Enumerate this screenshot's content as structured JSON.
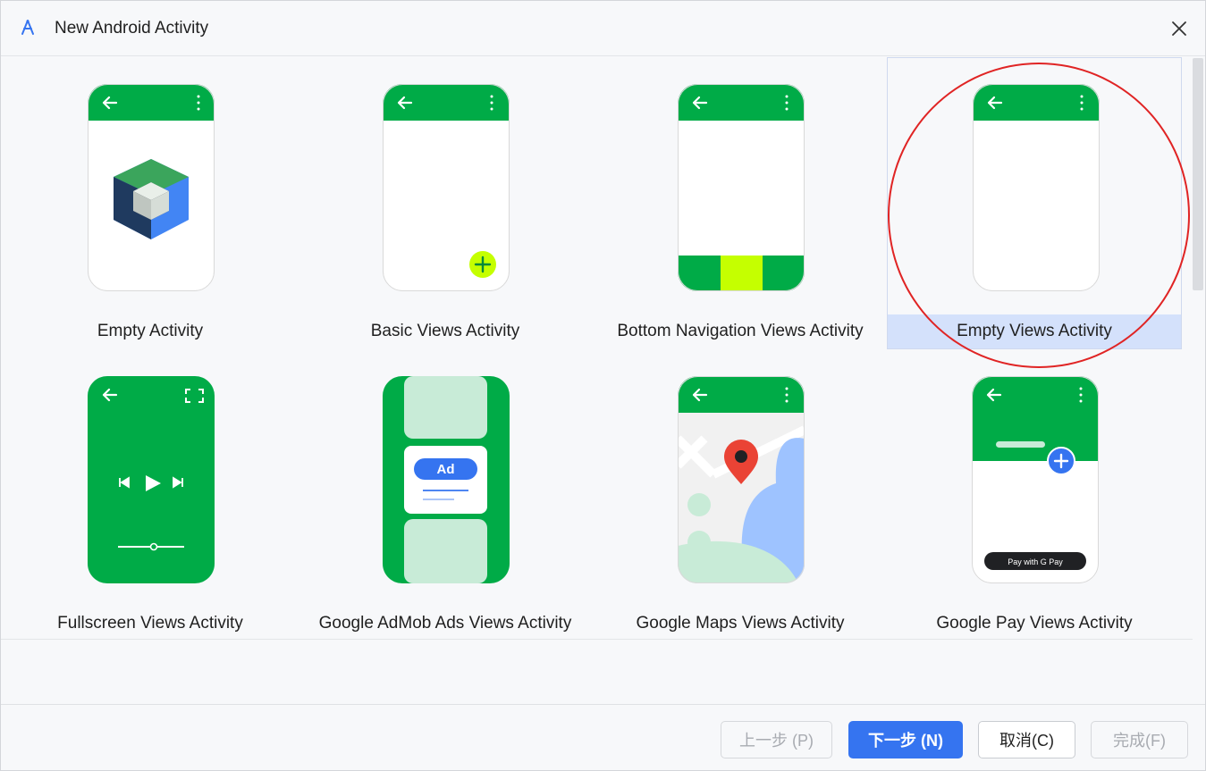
{
  "window": {
    "title": "New Android Activity"
  },
  "templates": [
    {
      "label": "Empty Activity"
    },
    {
      "label": "Basic Views Activity"
    },
    {
      "label": "Bottom Navigation Views Activity"
    },
    {
      "label": "Empty Views Activity",
      "selected": true
    },
    {
      "label": "Fullscreen Views Activity"
    },
    {
      "label": "Google AdMob Ads Views Activity",
      "ad_badge": "Ad"
    },
    {
      "label": "Google Maps Views Activity"
    },
    {
      "label": "Google Pay Views Activity",
      "pay_button": "Pay with G Pay"
    }
  ],
  "footer": {
    "previous_label": "上一步 (P)",
    "next_label": "下一步 (N)",
    "cancel_label": "取消(C)",
    "finish_label": "完成(F)"
  },
  "colors": {
    "android_green": "#00ab47",
    "light_green": "#c8ebd7",
    "lime": "#c5ff00",
    "primary_blue": "#3574f0",
    "selection": "#d4e1fb",
    "annotation_red": "#e02424"
  }
}
